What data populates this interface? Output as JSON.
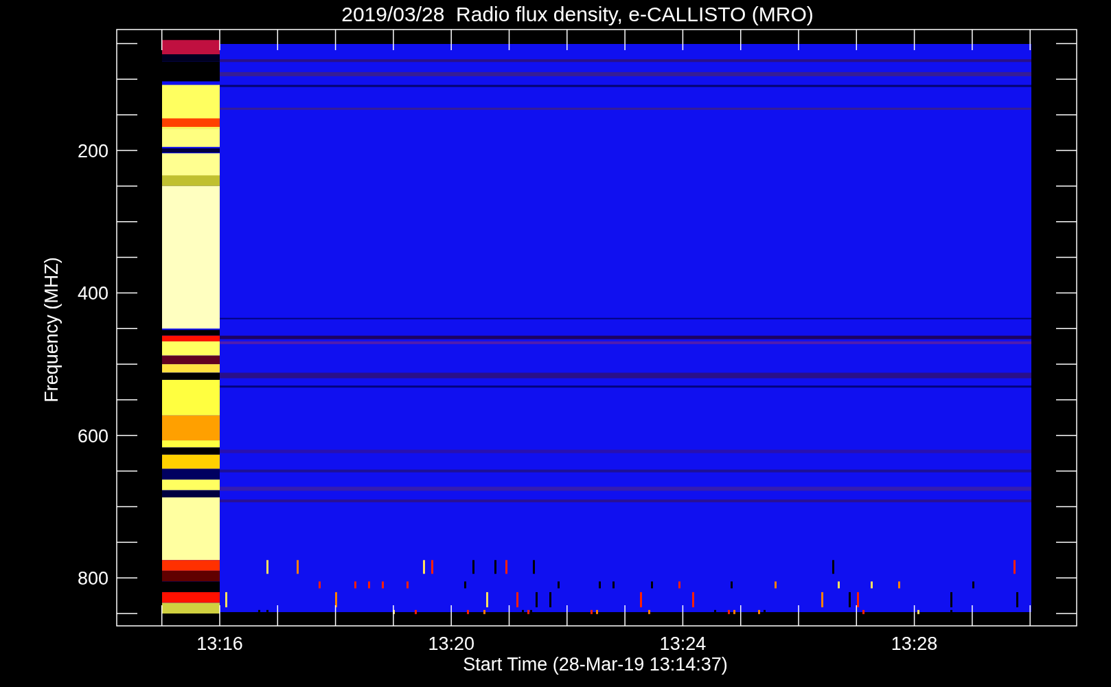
{
  "title": "2019/03/28  Radio flux density, e-CALLISTO (MRO)",
  "y_axis": {
    "label": "Frequency (MHZ)",
    "ticks": [
      "200",
      "400",
      "600",
      "800"
    ]
  },
  "x_axis": {
    "label": "Start Time (28-Mar-19 13:14:37)",
    "ticks": [
      "13:16",
      "13:20",
      "13:24",
      "13:28"
    ]
  }
}
